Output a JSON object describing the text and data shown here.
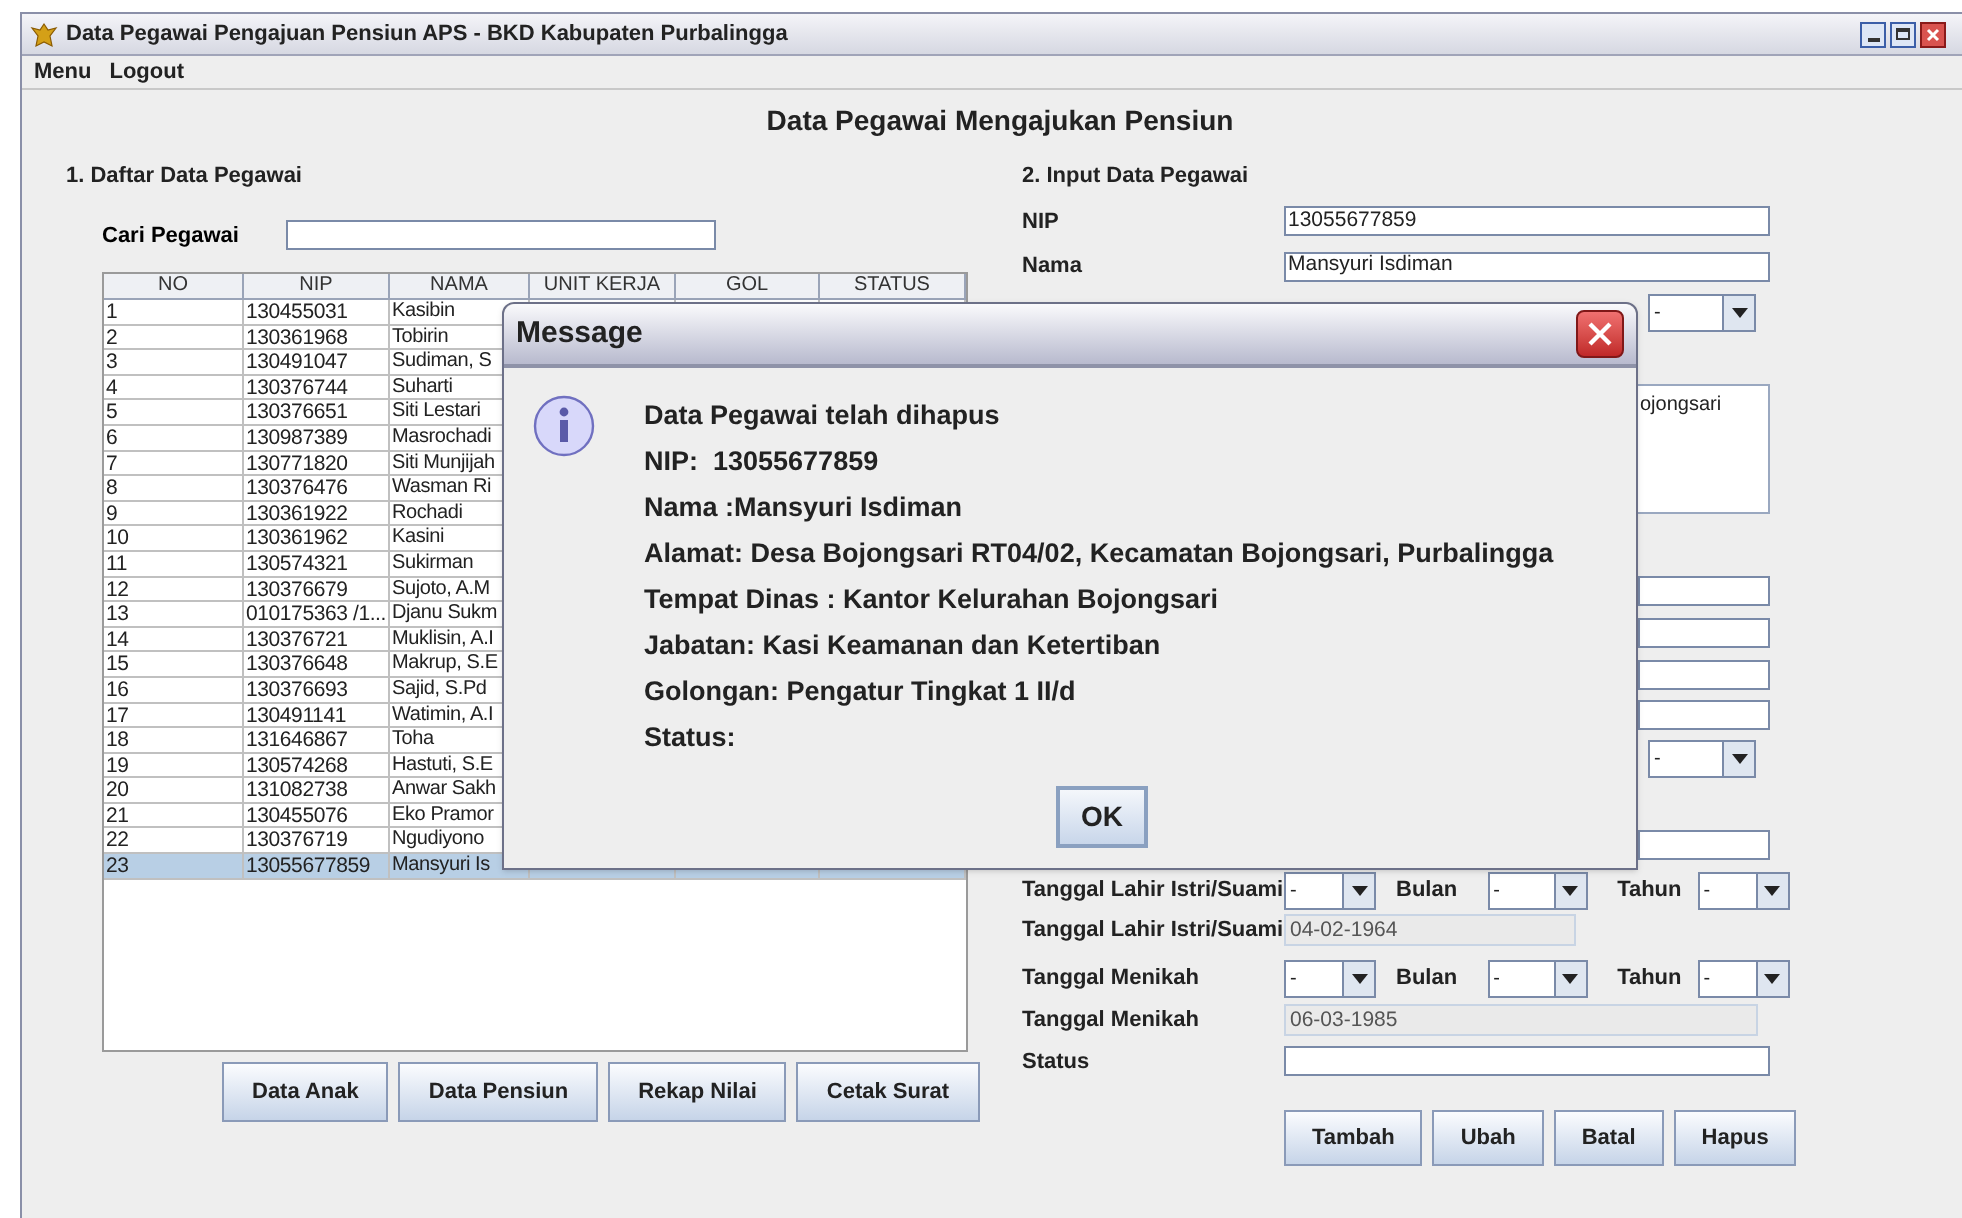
{
  "window": {
    "title": "Data Pegawai Pengajuan Pensiun APS - BKD Kabupaten Purbalingga"
  },
  "menu": [
    "Menu",
    "Logout"
  ],
  "heading": "Data Pegawai Mengajukan Pensiun",
  "left_panel": {
    "title": "1. Daftar Data Pegawai",
    "search_label": "Cari Pegawai",
    "table": {
      "columns": [
        "NO",
        "NIP",
        "NAMA",
        "UNIT KERJA",
        "GOL",
        "STATUS"
      ],
      "rows": [
        {
          "cells": [
            "1",
            "130455031",
            "Kasibin"
          ],
          "selected": false
        },
        {
          "cells": [
            "2",
            "130361968",
            "Tobirin"
          ],
          "selected": false
        },
        {
          "cells": [
            "3",
            "130491047",
            "Sudiman, S"
          ],
          "selected": false
        },
        {
          "cells": [
            "4",
            "130376744",
            "Suharti"
          ],
          "selected": false
        },
        {
          "cells": [
            "5",
            "130376651",
            "Siti Lestari"
          ],
          "selected": false
        },
        {
          "cells": [
            "6",
            "130987389",
            "Masrochadi"
          ],
          "selected": false
        },
        {
          "cells": [
            "7",
            "130771820",
            "Siti Munjijah"
          ],
          "selected": false
        },
        {
          "cells": [
            "8",
            "130376476",
            "Wasman Ri"
          ],
          "selected": false
        },
        {
          "cells": [
            "9",
            "130361922",
            "Rochadi"
          ],
          "selected": false
        },
        {
          "cells": [
            "10",
            "130361962",
            "Kasini"
          ],
          "selected": false
        },
        {
          "cells": [
            "11",
            "130574321",
            "Sukirman"
          ],
          "selected": false
        },
        {
          "cells": [
            "12",
            "130376679",
            "Sujoto, A.M"
          ],
          "selected": false
        },
        {
          "cells": [
            "13",
            "010175363 /1...",
            "Djanu Sukm"
          ],
          "selected": false
        },
        {
          "cells": [
            "14",
            "130376721",
            "Muklisin, A.I"
          ],
          "selected": false
        },
        {
          "cells": [
            "15",
            "130376648",
            "Makrup, S.E"
          ],
          "selected": false
        },
        {
          "cells": [
            "16",
            "130376693",
            "Sajid, S.Pd"
          ],
          "selected": false
        },
        {
          "cells": [
            "17",
            "130491141",
            "Watimin, A.I"
          ],
          "selected": false
        },
        {
          "cells": [
            "18",
            "131646867",
            "Toha"
          ],
          "selected": false
        },
        {
          "cells": [
            "19",
            "130574268",
            "Hastuti, S.E"
          ],
          "selected": false
        },
        {
          "cells": [
            "20",
            "131082738",
            "Anwar Sakh"
          ],
          "selected": false
        },
        {
          "cells": [
            "21",
            "130455076",
            "Eko Pramor"
          ],
          "selected": false
        },
        {
          "cells": [
            "22",
            "130376719",
            "Ngudiyono"
          ],
          "selected": false
        },
        {
          "cells": [
            "23",
            "13055677859",
            "Mansyuri Is"
          ],
          "selected": true
        }
      ]
    },
    "buttons": [
      "Data Anak",
      "Data Pensiun",
      "Rekap Nilai",
      "Cetak Surat"
    ]
  },
  "right_panel": {
    "title": "2. Input Data Pegawai",
    "rows": [
      {
        "kind": "text",
        "label": "NIP",
        "value": "13055677859"
      },
      {
        "kind": "text",
        "label": "Nama",
        "value": "Mansyuri Isdiman"
      },
      {
        "kind": "combo_only",
        "value": "-"
      },
      {
        "kind": "textarea",
        "value": "ojongsari"
      },
      {
        "kind": "text"
      },
      {
        "kind": "text"
      },
      {
        "kind": "text"
      },
      {
        "kind": "text"
      },
      {
        "kind": "combo_only",
        "value": "-"
      },
      {
        "kind": "text"
      },
      {
        "kind": "date_combos",
        "label": "Tanggal Lahir Istri/Suami",
        "combos": [
          {
            "value": "-"
          },
          {
            "label": "Bulan",
            "value": "-"
          },
          {
            "label": "Tahun",
            "value": "-"
          }
        ]
      },
      {
        "kind": "readonly",
        "label": "Tanggal Lahir Istri/Suami",
        "value": "04-02-1964",
        "wide": false
      },
      {
        "kind": "date_combos",
        "label": "Tanggal Menikah",
        "combos": [
          {
            "value": "-"
          },
          {
            "label": "Bulan",
            "value": "-"
          },
          {
            "label": "Tahun",
            "value": "-"
          }
        ]
      },
      {
        "kind": "readonly",
        "label": "Tanggal Menikah",
        "value": "06-03-1985",
        "wide": true
      },
      {
        "kind": "text",
        "label": "Status"
      }
    ],
    "buttons": [
      "Tambah",
      "Ubah",
      "Batal",
      "Hapus"
    ]
  },
  "dialog": {
    "title": "Message",
    "lines": [
      "Data Pegawai telah dihapus",
      "NIP:  13055677859",
      "Nama :Mansyuri Isdiman",
      "Alamat: Desa Bojongsari RT04/02, Kecamatan Bojongsari, Purbalingga",
      "Tempat Dinas : Kantor Kelurahan Bojongsari",
      "Jabatan: Kasi Keamanan dan Ketertiban",
      "Golongan: Pengatur Tingkat 1 II/d",
      "Status:"
    ],
    "button": "OK"
  }
}
